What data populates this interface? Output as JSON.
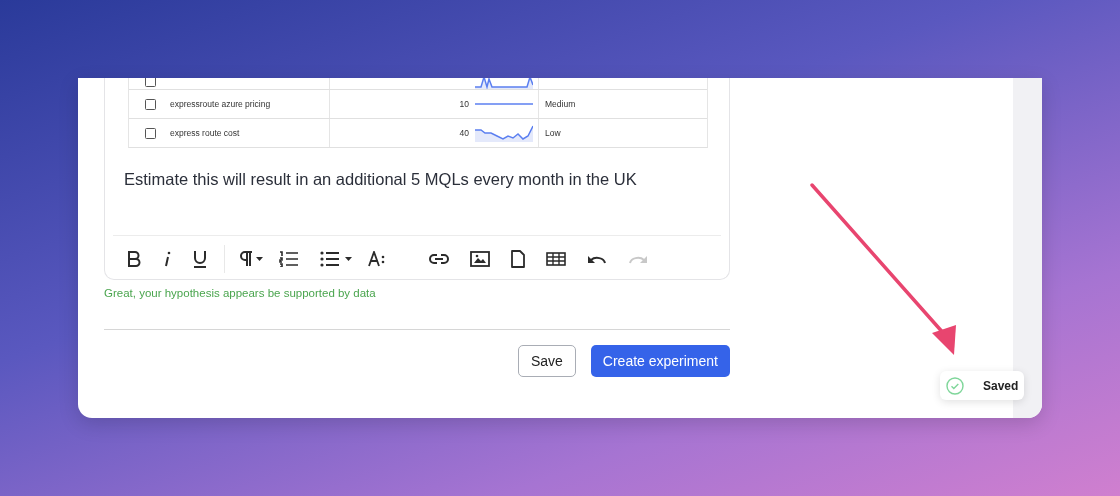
{
  "table": {
    "rows": [
      {
        "checked": false,
        "kind": "spike"
      },
      {
        "checked": false,
        "keyword": "expressroute azure pricing",
        "volume": "10",
        "kind": "flat",
        "competition": "Medium"
      },
      {
        "checked": false,
        "keyword": "express route cost",
        "volume": "40",
        "kind": "rising",
        "competition": "Low"
      }
    ]
  },
  "editor": {
    "text": "Estimate this will result in an additional 5 MQLs every month in the UK",
    "toolbar": [
      {
        "kind": "bold",
        "disabled": false
      },
      {
        "kind": "italic",
        "disabled": false
      },
      {
        "kind": "underline",
        "disabled": false
      },
      {
        "kind": "sep"
      },
      {
        "kind": "paragraph",
        "disabled": false
      },
      {
        "kind": "ordered",
        "disabled": false
      },
      {
        "kind": "bullets",
        "disabled": false
      },
      {
        "kind": "fontsize",
        "disabled": false
      },
      {
        "kind": "gap"
      },
      {
        "kind": "link",
        "disabled": false
      },
      {
        "kind": "image",
        "disabled": false
      },
      {
        "kind": "file",
        "disabled": false
      },
      {
        "kind": "table",
        "disabled": false
      },
      {
        "kind": "undo",
        "disabled": false
      },
      {
        "kind": "redo",
        "disabled": true
      }
    ]
  },
  "hint": "Great, your hypothesis appears be supported by data",
  "buttons": [
    {
      "label": "Save",
      "kind": "secondary"
    },
    {
      "label": "Create experiment",
      "kind": "primary"
    }
  ],
  "toast": {
    "label": "Saved"
  }
}
